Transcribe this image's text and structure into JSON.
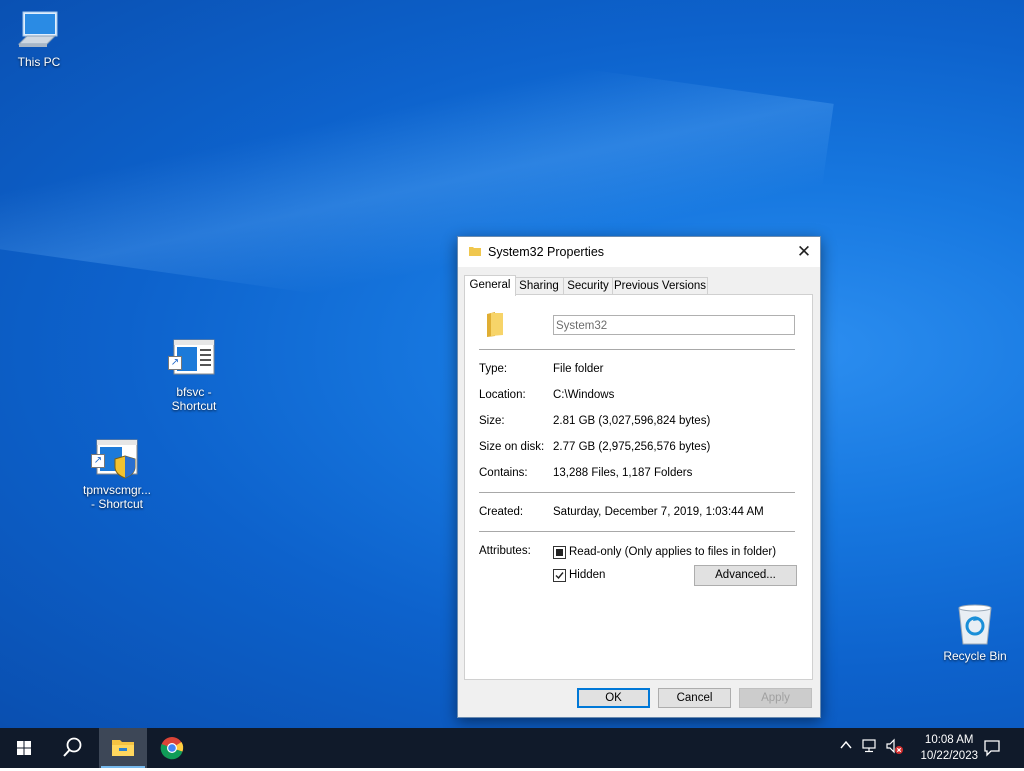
{
  "desktop": {
    "icons": [
      {
        "label": "This PC"
      },
      {
        "label": "bfsvc -\nShortcut"
      },
      {
        "label": "tpmvscmgr...\n- Shortcut"
      },
      {
        "label": "Recycle Bin"
      }
    ]
  },
  "dialog": {
    "title": "System32 Properties",
    "close_glyph": "✕",
    "tabs": [
      "General",
      "Sharing",
      "Security",
      "Previous Versions"
    ],
    "active_tab": "General",
    "folder_name": "System32",
    "rows": [
      {
        "label": "Type:",
        "value": "File folder"
      },
      {
        "label": "Location:",
        "value": "C:\\Windows"
      },
      {
        "label": "Size:",
        "value": "2.81 GB (3,027,596,824 bytes)"
      },
      {
        "label": "Size on disk:",
        "value": "2.77 GB (2,975,256,576 bytes)"
      },
      {
        "label": "Contains:",
        "value": "13,288 Files, 1,187 Folders"
      }
    ],
    "created_label": "Created:",
    "created_value": "Saturday, December 7, 2019, 1:03:44 AM",
    "attributes_label": "Attributes:",
    "readonly_label": "Read-only (Only applies to files in folder)",
    "readonly_state": "indeterminate",
    "hidden_label": "Hidden",
    "hidden_checked": true,
    "advanced_label": "Advanced...",
    "ok_label": "OK",
    "cancel_label": "Cancel",
    "apply_label": "Apply"
  },
  "taskbar": {
    "time": "10:08 AM",
    "date": "10/22/2023",
    "pinned": [
      "start-icon",
      "search-icon",
      "file-explorer-icon",
      "chrome-icon"
    ]
  },
  "colors": {
    "accent": "#0078d7",
    "taskbar": "#101a2a",
    "desktop": "#0d62cc"
  }
}
